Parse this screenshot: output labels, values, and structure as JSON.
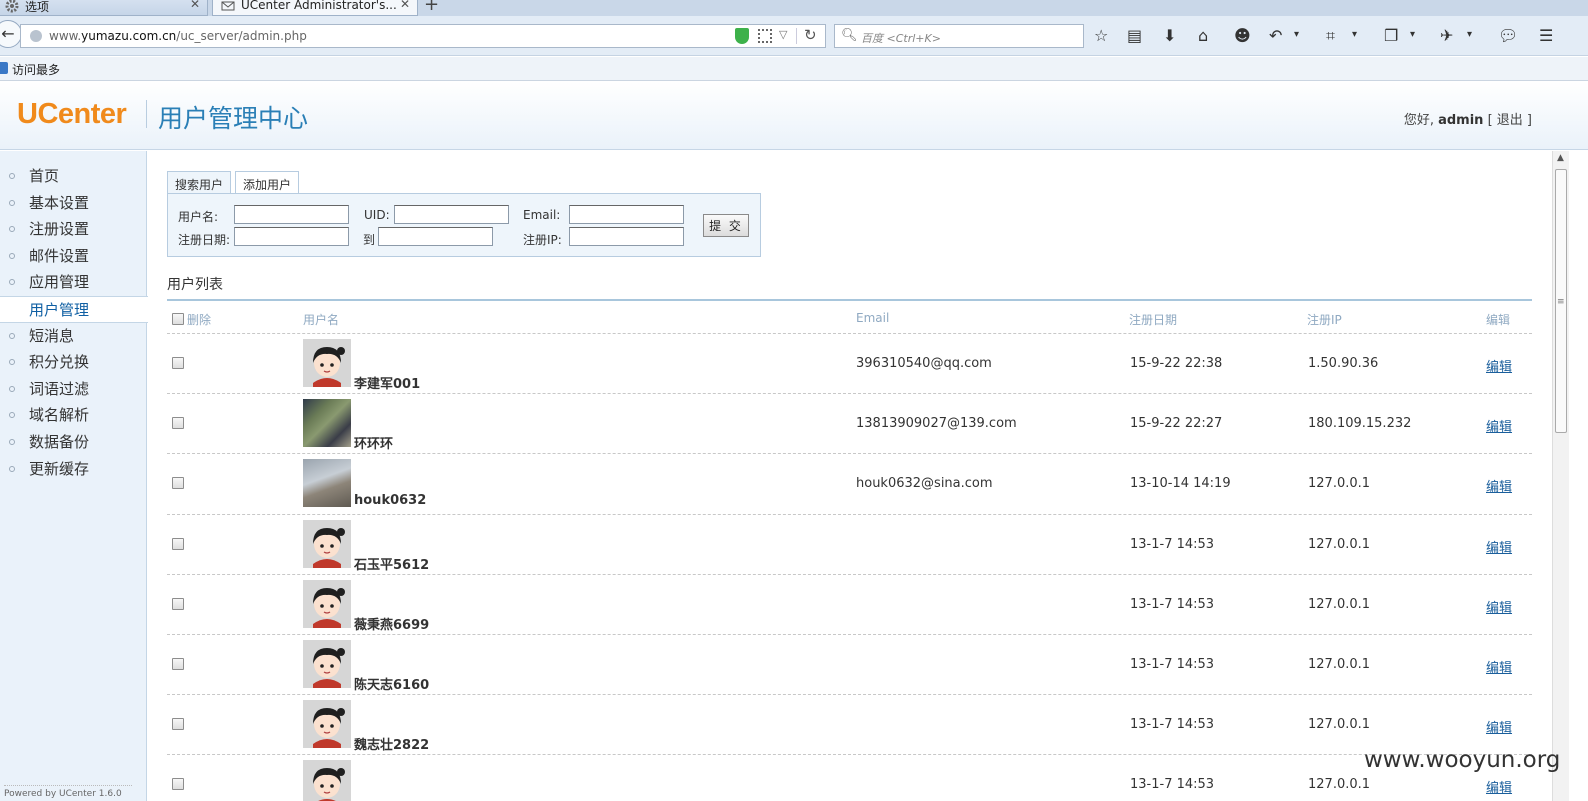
{
  "browser": {
    "tabs": [
      {
        "label": "选项",
        "icon": "gear-icon"
      },
      {
        "label": "UCenter Administrator's...",
        "icon": "mail-icon"
      }
    ],
    "new_tab": "+",
    "url_prefix": "www.",
    "url_domain": "yumazu.com.cn",
    "url_path": "/uc_server/admin.php",
    "search_placeholder": "百度 <Ctrl+K>",
    "bookmark": "访问最多"
  },
  "header": {
    "logo": "UCenter",
    "title": "用户管理中心",
    "greeting": "您好,",
    "username": "admin",
    "logout": "[ 退出 ]"
  },
  "sidebar": {
    "items": [
      {
        "label": "首页"
      },
      {
        "label": "基本设置"
      },
      {
        "label": "注册设置"
      },
      {
        "label": "邮件设置"
      },
      {
        "label": "应用管理"
      },
      {
        "label": "用户管理",
        "active": true
      },
      {
        "label": "短消息"
      },
      {
        "label": "积分兑换"
      },
      {
        "label": "词语过滤"
      },
      {
        "label": "域名解析"
      },
      {
        "label": "数据备份"
      },
      {
        "label": "更新缓存"
      }
    ],
    "powered": "Powered by UCenter 1.6.0"
  },
  "search_tabs": [
    "搜索用户",
    "添加用户"
  ],
  "search_form": {
    "username_label": "用户名:",
    "uid_label": "UID:",
    "email_label": "Email:",
    "regdate_label": "注册日期:",
    "to_label": "到",
    "regip_label": "注册IP:",
    "submit": "提 交"
  },
  "list": {
    "title": "用户列表",
    "columns": [
      "删除",
      "用户名",
      "Email",
      "注册日期",
      "注册IP",
      "编辑"
    ],
    "rows": [
      {
        "username": "李建军001",
        "email": "396310540@qq.com",
        "date": "15-9-22 22:38",
        "ip": "1.50.90.36",
        "edit": "编辑",
        "avatar": "default"
      },
      {
        "username": "环环环",
        "email": "13813909027@139.com",
        "date": "15-9-22 22:27",
        "ip": "180.109.15.232",
        "edit": "编辑",
        "avatar": "photo1"
      },
      {
        "username": "houk0632",
        "email": "houk0632@sina.com",
        "date": "13-10-14 14:19",
        "ip": "127.0.0.1",
        "edit": "编辑",
        "avatar": "photo2"
      },
      {
        "username": "石玉平5612",
        "email": "",
        "date": "13-1-7 14:53",
        "ip": "127.0.0.1",
        "edit": "编辑",
        "avatar": "default"
      },
      {
        "username": "薇秉燕6699",
        "email": "",
        "date": "13-1-7 14:53",
        "ip": "127.0.0.1",
        "edit": "编辑",
        "avatar": "default"
      },
      {
        "username": "陈天志6160",
        "email": "",
        "date": "13-1-7 14:53",
        "ip": "127.0.0.1",
        "edit": "编辑",
        "avatar": "default"
      },
      {
        "username": "魏志壮2822",
        "email": "",
        "date": "13-1-7 14:53",
        "ip": "127.0.0.1",
        "edit": "编辑",
        "avatar": "default"
      },
      {
        "username": "",
        "email": "",
        "date": "13-1-7 14:53",
        "ip": "127.0.0.1",
        "edit": "编辑",
        "avatar": "default"
      }
    ]
  },
  "watermark": "www.wooyun.org",
  "colors": {
    "brand_orange": "#f08a1c",
    "title_blue": "#2a7fb6",
    "link_blue": "#1b5f9c"
  }
}
